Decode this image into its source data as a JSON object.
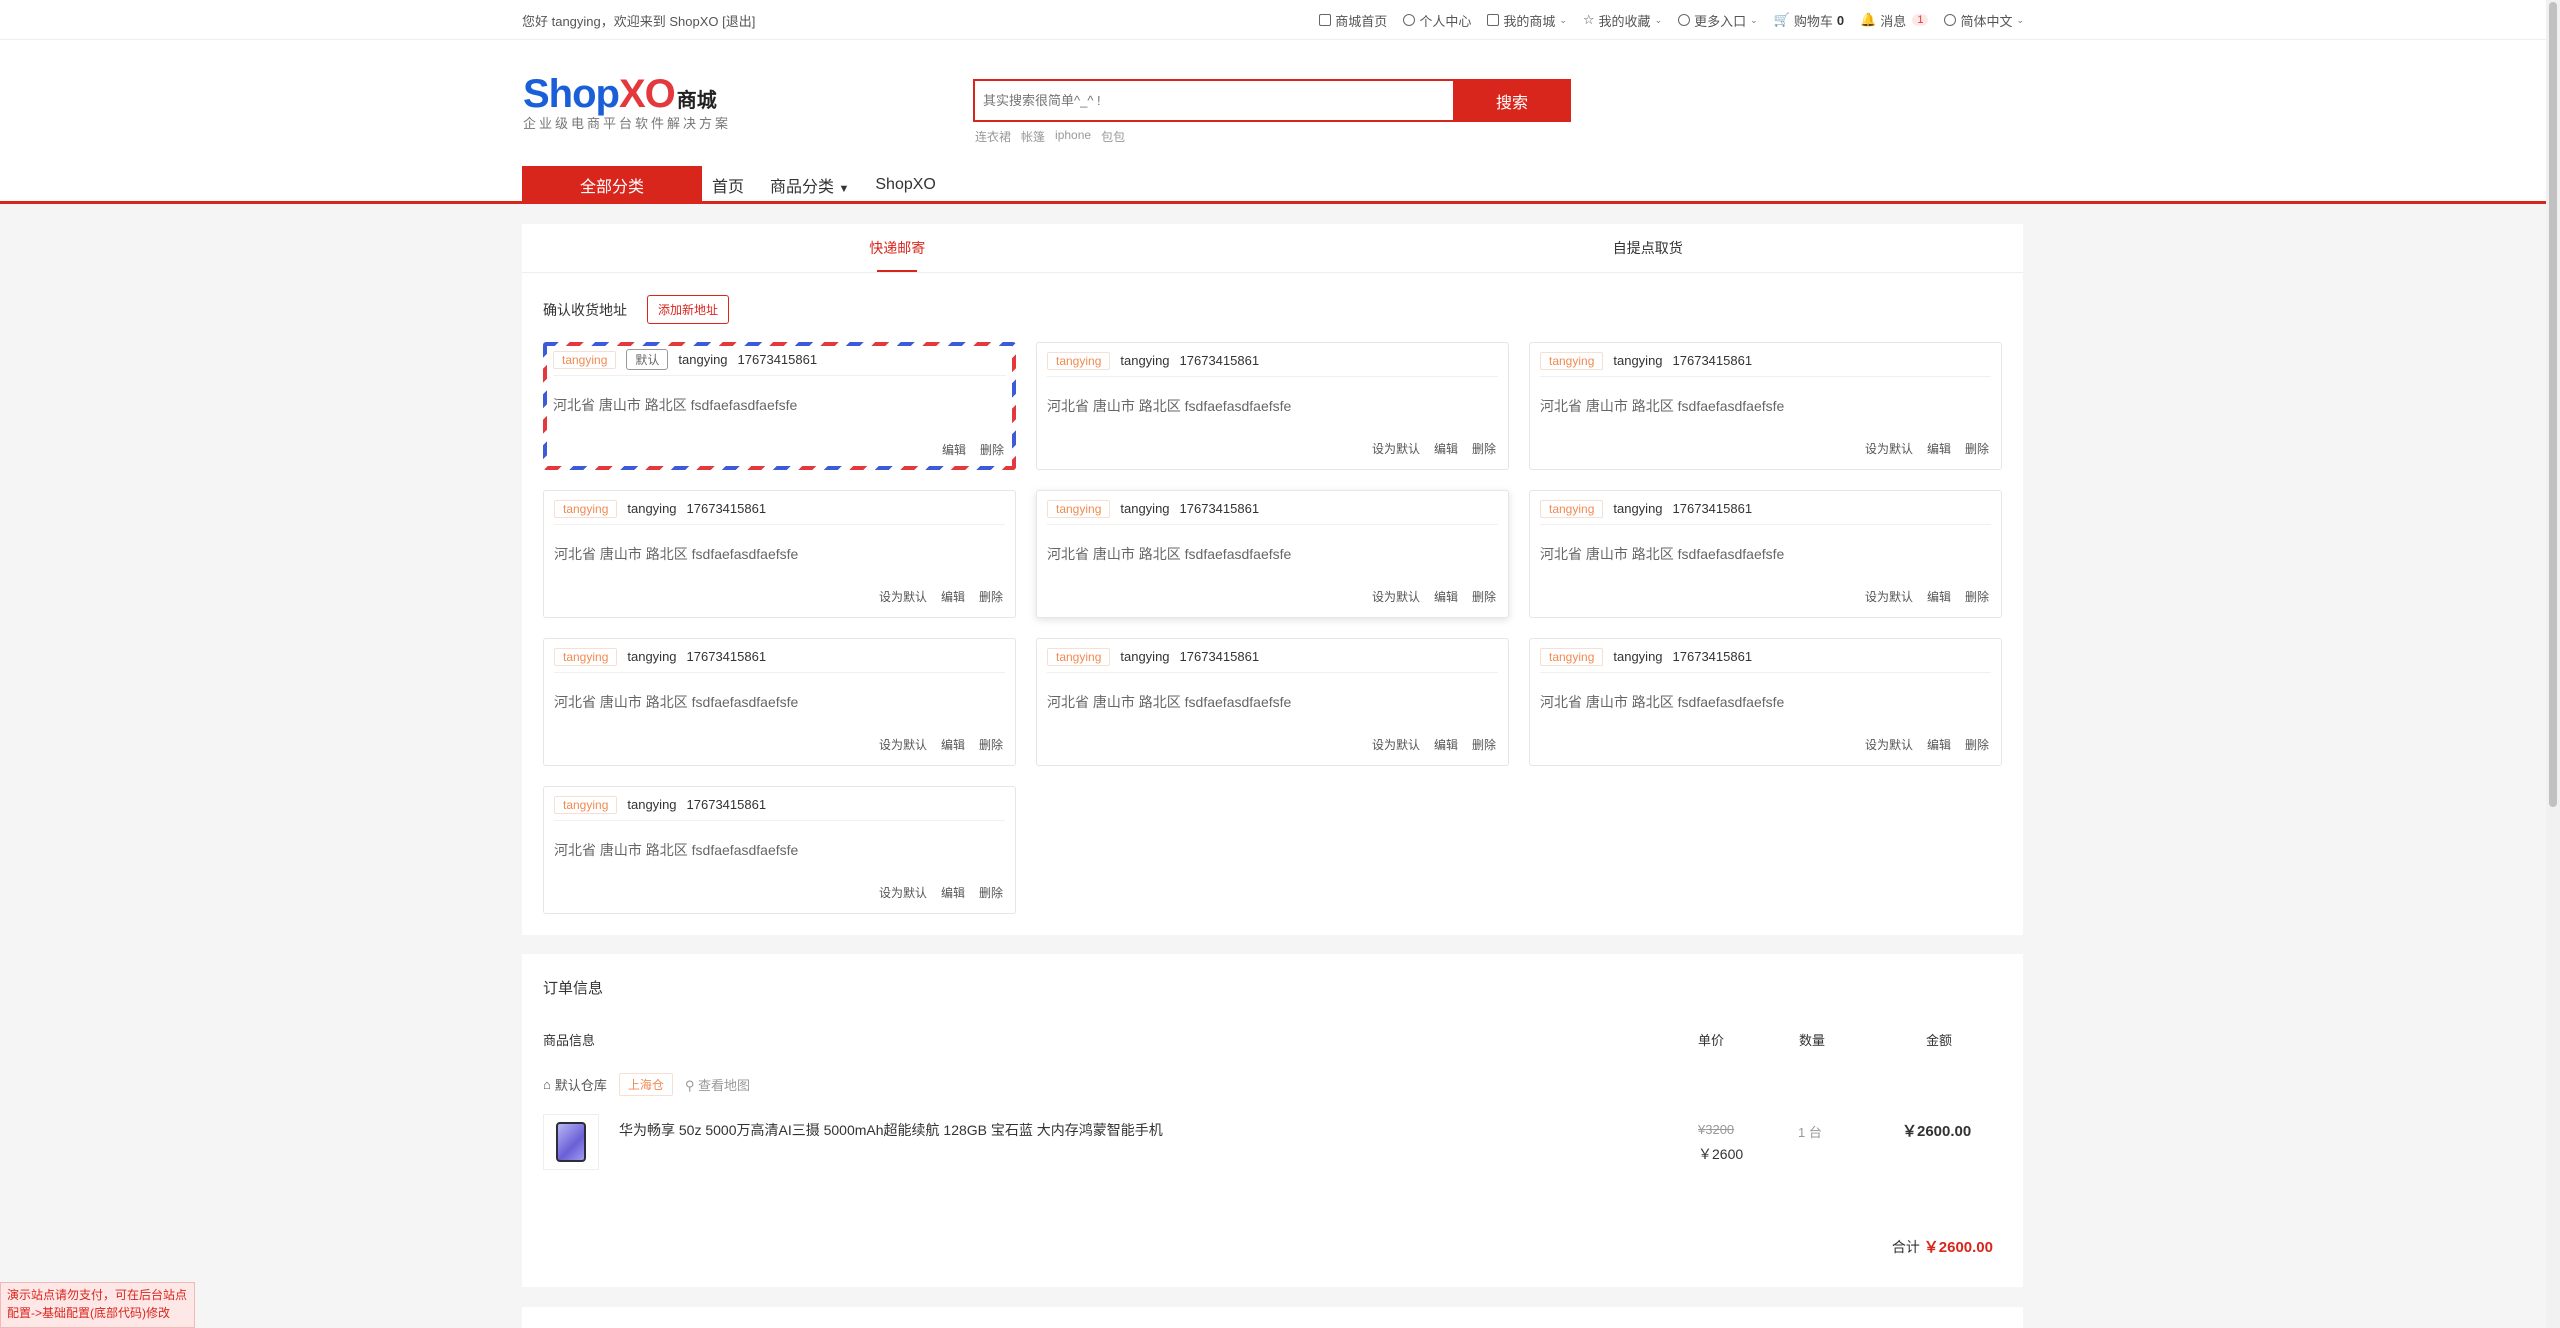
{
  "topbar": {
    "greeting": "您好 tangying，欢迎来到 ShopXO [退出]",
    "links": {
      "home": "商城首页",
      "ucenter": "个人中心",
      "myshop": "我的商城",
      "favor": "我的收藏",
      "more": "更多入口",
      "cart_label": "购物车",
      "cart_count": "0",
      "msg_label": "消息",
      "msg_count": "1",
      "lang": "简体中文"
    }
  },
  "header": {
    "logo_shop": "Shop",
    "logo_xo": "XO",
    "logo_mall": "商城",
    "slogan": "企业级电商平台软件解决方案",
    "search_placeholder": "其实搜索很简单^_^ !",
    "search_button": "搜索",
    "hotwords": [
      "连衣裙",
      "帐篷",
      "iphone",
      "包包"
    ],
    "nav": {
      "all": "全部分类",
      "home": "首页",
      "category": "商品分类",
      "shopxo": "ShopXO"
    }
  },
  "tabs": {
    "express": "快递邮寄",
    "pickup": "自提点取货"
  },
  "address": {
    "title": "确认收货地址",
    "add_button": "添加新地址",
    "default_label": "默认",
    "set_default": "设为默认",
    "edit": "编辑",
    "delete": "删除",
    "items": [
      {
        "tag": "tangying",
        "name": "tangying",
        "phone": "17673415861",
        "detail": "河北省 唐山市 路北区 fsdfaefasdfaefsfe"
      },
      {
        "tag": "tangying",
        "name": "tangying",
        "phone": "17673415861",
        "detail": "河北省 唐山市 路北区 fsdfaefasdfaefsfe"
      },
      {
        "tag": "tangying",
        "name": "tangying",
        "phone": "17673415861",
        "detail": "河北省 唐山市 路北区 fsdfaefasdfaefsfe"
      },
      {
        "tag": "tangying",
        "name": "tangying",
        "phone": "17673415861",
        "detail": "河北省 唐山市 路北区 fsdfaefasdfaefsfe"
      },
      {
        "tag": "tangying",
        "name": "tangying",
        "phone": "17673415861",
        "detail": "河北省 唐山市 路北区 fsdfaefasdfaefsfe"
      },
      {
        "tag": "tangying",
        "name": "tangying",
        "phone": "17673415861",
        "detail": "河北省 唐山市 路北区 fsdfaefasdfaefsfe"
      },
      {
        "tag": "tangying",
        "name": "tangying",
        "phone": "17673415861",
        "detail": "河北省 唐山市 路北区 fsdfaefasdfaefsfe"
      },
      {
        "tag": "tangying",
        "name": "tangying",
        "phone": "17673415861",
        "detail": "河北省 唐山市 路北区 fsdfaefasdfaefsfe"
      },
      {
        "tag": "tangying",
        "name": "tangying",
        "phone": "17673415861",
        "detail": "河北省 唐山市 路北区 fsdfaefasdfaefsfe"
      },
      {
        "tag": "tangying",
        "name": "tangying",
        "phone": "17673415861",
        "detail": "河北省 唐山市 路北区 fsdfaefasdfaefsfe"
      }
    ]
  },
  "order": {
    "title": "订单信息",
    "cols": {
      "goods": "商品信息",
      "price": "单价",
      "qty": "数量",
      "amount": "金额"
    },
    "warehouse": "默认仓库",
    "warehouse_tag": "上海仓",
    "view_map": "查看地图",
    "product": {
      "name": "华为畅享 50z 5000万高清AI三摄 5000mAh超能续航 128GB 宝石蓝 大内存鸿蒙智能手机",
      "original_price": "¥3200",
      "price": "￥2600",
      "qty": "1 台",
      "amount": "￥2600.00"
    },
    "total_label": "合计",
    "total_value": "￥2600.00"
  },
  "demo_notice": "演示站点请勿支付，可在后台站点配置->基础配置(底部代码)修改",
  "colors": {
    "accent": "#d9261c",
    "logo_blue": "#1a5fd8",
    "tag_orange": "#f08b52"
  }
}
